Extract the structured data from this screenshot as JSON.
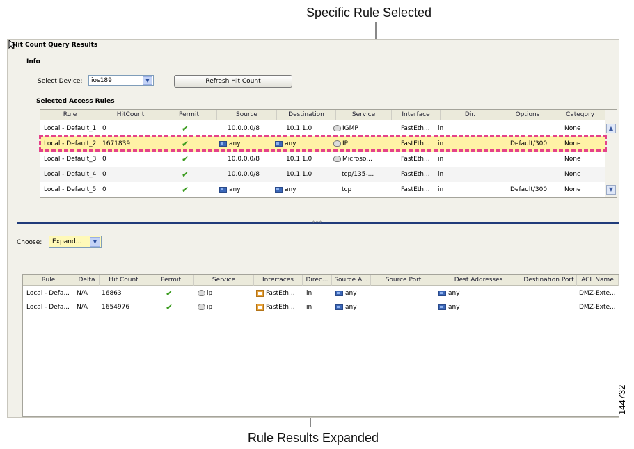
{
  "callouts": {
    "top": "Specific Rule Selected",
    "bottom": "Rule Results Expanded",
    "figure_id": "144732"
  },
  "window": {
    "title": "Hit Count Query Results",
    "info_label": "Info",
    "device_label": "Select Device:",
    "device_value": "ios189",
    "refresh_button": "Refresh Hit Count",
    "rules_label": "Selected Access Rules"
  },
  "top_table": {
    "columns": [
      "Rule",
      "HitCount",
      "Permit",
      "Source",
      "Destination",
      "Service",
      "Interface",
      "Dir.",
      "Options",
      "Category"
    ],
    "rows": [
      {
        "rule": "Local - Default_1",
        "hit": "0",
        "source": "10.0.0.0/8",
        "destination": "10.1.1.0",
        "service": "IGMP",
        "interface": "FastEth...",
        "dir": "in",
        "options": "",
        "category": "None"
      },
      {
        "rule": "Local - Default_2",
        "hit": "1671839",
        "source": "any",
        "destination": "any",
        "service": "IP",
        "interface": "FastEth...",
        "dir": "in",
        "options": "Default/300",
        "category": "None"
      },
      {
        "rule": "Local - Default_3",
        "hit": "0",
        "source": "10.0.0.0/8",
        "destination": "10.1.1.0",
        "service": "Microso...",
        "interface": "FastEth...",
        "dir": "in",
        "options": "",
        "category": "None"
      },
      {
        "rule": "Local - Default_4",
        "hit": "0",
        "source": "10.0.0.0/8",
        "destination": "10.1.1.0",
        "service": "tcp/135-...",
        "interface": "FastEth...",
        "dir": "in",
        "options": "",
        "category": "None"
      },
      {
        "rule": "Local - Default_5",
        "hit": "0",
        "source": "any",
        "destination": "any",
        "service": "tcp",
        "interface": "FastEth...",
        "dir": "in",
        "options": "Default/300",
        "category": "None"
      }
    ]
  },
  "choose": {
    "label": "Choose:",
    "value": "Expand..."
  },
  "bottom_table": {
    "columns": [
      "Rule",
      "Delta",
      "Hit Count",
      "Permit",
      "Service",
      "Interfaces",
      "Direc...",
      "Source A...",
      "Source Port",
      "Dest Addresses",
      "Destination Port",
      "ACL Name"
    ],
    "rows": [
      {
        "rule": "Local - Defa...",
        "delta": "N/A",
        "hit": "16863",
        "service": "ip",
        "interfaces": "FastEth...",
        "direction": "in",
        "source": "any",
        "source_port": "",
        "dest": "any",
        "dest_port": "",
        "acl": "DMZ-Exte..."
      },
      {
        "rule": "Local - Defa...",
        "delta": "N/A",
        "hit": "1654976",
        "service": "ip",
        "interfaces": "FastEth...",
        "direction": "in",
        "source": "any",
        "source_port": "",
        "dest": "any",
        "dest_port": "",
        "acl": "DMZ-Exte..."
      }
    ]
  },
  "glyphs": {
    "check": "✔",
    "down_arrow": "▼",
    "up_arrow": "▲",
    "grip": "∗∗∗"
  },
  "colors": {
    "highlight_border": "#e4428a",
    "selected_row": "#fff2a6",
    "splitter": "#203b7a",
    "check": "#3a9b1e"
  }
}
